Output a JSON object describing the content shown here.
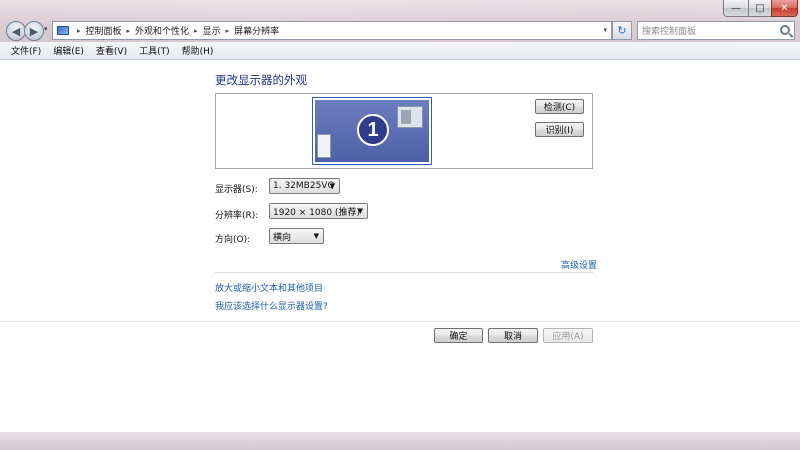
{
  "window": {
    "minimize_glyph": "—",
    "maximize_glyph": "□",
    "close_glyph": "✕"
  },
  "nav": {
    "back_glyph": "◀",
    "forward_glyph": "▶",
    "dropdown_glyph": "▾"
  },
  "address": {
    "breadcrumbs": [
      "控制面板",
      "外观和个性化",
      "显示",
      "屏幕分辨率"
    ],
    "separator": "▸",
    "dropdown_glyph": "▾"
  },
  "refresh_glyph": "↻",
  "search": {
    "placeholder": "搜索控制面板"
  },
  "menu": [
    "文件(F)",
    "编辑(E)",
    "查看(V)",
    "工具(T)",
    "帮助(H)"
  ],
  "page": {
    "title": "更改显示器的外观",
    "monitor_number": "1",
    "detect_label": "检测(C)",
    "identify_label": "识别(I)"
  },
  "form": {
    "display_label": "显示器(S):",
    "display_value": "1. 32MB25VQ",
    "resolution_label": "分辨率(R):",
    "resolution_value": "1920 × 1080 (推荐)",
    "orientation_label": "方向(O):",
    "orientation_value": "横向",
    "dropdown_glyph": "▼"
  },
  "links": {
    "advanced": "高级设置",
    "text_size": "放大或缩小文本和其他项目",
    "help": "我应该选择什么显示器设置?"
  },
  "footer": {
    "ok": "确定",
    "cancel": "取消",
    "apply": "应用(A)"
  },
  "colors": {
    "link": "#1a5fb4",
    "title": "#1e3287",
    "monitor_fill": "#4b5fa7"
  }
}
